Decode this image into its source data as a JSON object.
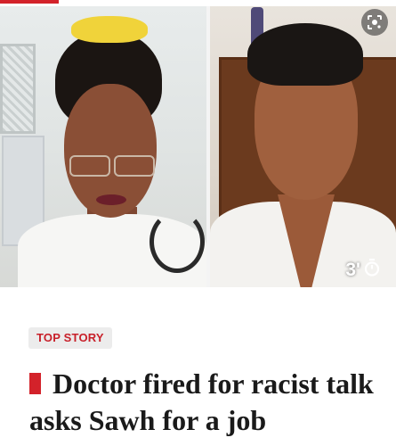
{
  "media": {
    "duration_label": "3'",
    "duration_icon": "stopwatch-icon",
    "lens_icon": "google-lens-icon",
    "left_photo": "doctor-woman-video-frame",
    "right_photo": "man-video-frame"
  },
  "article": {
    "tag_label": "TOP STORY",
    "headline": "Doctor fired for racist talk asks Sawh for a job"
  },
  "colors": {
    "accent": "#d3222a",
    "tag_background": "#ececec",
    "headline_text": "#1a1a1a"
  }
}
